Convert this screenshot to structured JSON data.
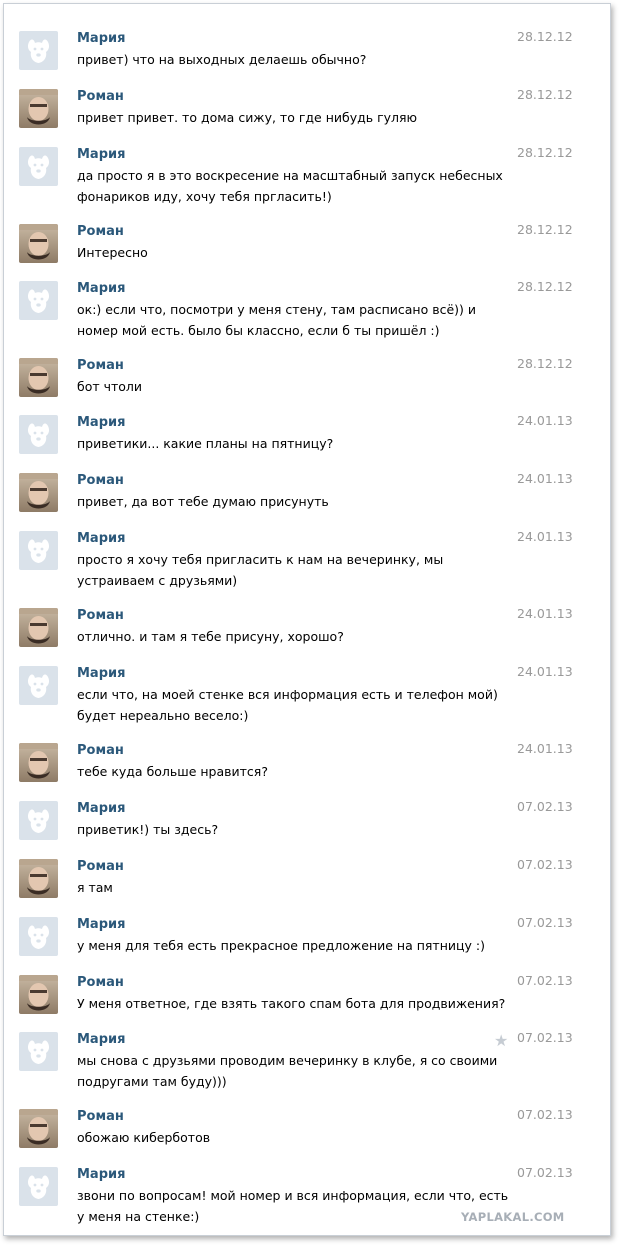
{
  "messages": [
    {
      "author": "Мария",
      "avatar": "dog-avatar-icon",
      "text": "привет) что на выходных делаешь обычно?",
      "date": "28.12.12"
    },
    {
      "author": "Роман",
      "avatar": "photo-avatar",
      "text": "привет привет. то дома сижу, то где нибудь гуляю",
      "date": "28.12.12"
    },
    {
      "author": "Мария",
      "avatar": "dog-avatar-icon",
      "text": "да просто я в это воскресение на масштабный запуск небесных\nфонариков иду, хочу тебя прглаcить!)",
      "date": "28.12.12"
    },
    {
      "author": "Роман",
      "avatar": "photo-avatar",
      "text": "Интересно",
      "date": "28.12.12"
    },
    {
      "author": "Мария",
      "avatar": "dog-avatar-icon",
      "text": "ок:) если что, посмотри у меня стену, там расписано всё)) и\nномер мой есть. было бы классно, если б ты пришёл :)",
      "date": "28.12.12"
    },
    {
      "author": "Роман",
      "avatar": "photo-avatar",
      "text": "бот чтоли",
      "date": "28.12.12"
    },
    {
      "author": "Мария",
      "avatar": "dog-avatar-icon",
      "text": "приветики... какие планы на пятницу?",
      "date": "24.01.13"
    },
    {
      "author": "Роман",
      "avatar": "photo-avatar",
      "text": "привет, да вот тебе думаю присунуть",
      "date": "24.01.13"
    },
    {
      "author": "Мария",
      "avatar": "dog-avatar-icon",
      "text": "просто я хочу тебя пригласить к нам на вечеринку, мы\nустраиваем с друзьями)",
      "date": "24.01.13"
    },
    {
      "author": "Роман",
      "avatar": "photo-avatar",
      "text": "отлично. и там я тебе присуну, хорошо?",
      "date": "24.01.13"
    },
    {
      "author": "Мария",
      "avatar": "dog-avatar-icon",
      "text": "если что, на моей стенке вся информация есть и телефон мой)\nбудет нереально весело:)",
      "date": "24.01.13"
    },
    {
      "author": "Роман",
      "avatar": "photo-avatar",
      "text": "тебе куда больше нравится?",
      "date": "24.01.13"
    },
    {
      "author": "Мария",
      "avatar": "dog-avatar-icon",
      "text": "приветик!) ты здесь?",
      "date": "07.02.13"
    },
    {
      "author": "Роман",
      "avatar": "photo-avatar",
      "text": "я там",
      "date": "07.02.13"
    },
    {
      "author": "Мария",
      "avatar": "dog-avatar-icon",
      "text": "у меня для тебя есть прекрасное предложение на пятницу :)",
      "date": "07.02.13"
    },
    {
      "author": "Роман",
      "avatar": "photo-avatar",
      "text": "У меня ответное, где взять такого спам бота для продвижения?",
      "date": "07.02.13"
    },
    {
      "author": "Мария",
      "avatar": "dog-avatar-icon",
      "text": "мы снова с друзьями проводим вечеринку в клубе, я со своими\nподругами там буду)))",
      "date": "07.02.13",
      "star": true
    },
    {
      "author": "Роман",
      "avatar": "photo-avatar",
      "text": "обожаю киберботов",
      "date": "07.02.13"
    },
    {
      "author": "Мария",
      "avatar": "dog-avatar-icon",
      "text": "звони по вопросам! мой номер и вся информация, если что, есть\nу меня на стенке:)",
      "date": "07.02.13"
    }
  ],
  "watermark": "YAPLAKAL.COM",
  "colors": {
    "author": "#2b587a",
    "date": "#999999",
    "text": "#000000",
    "avatar_bg": "#dae2ea",
    "star": "#c6ccd3"
  }
}
